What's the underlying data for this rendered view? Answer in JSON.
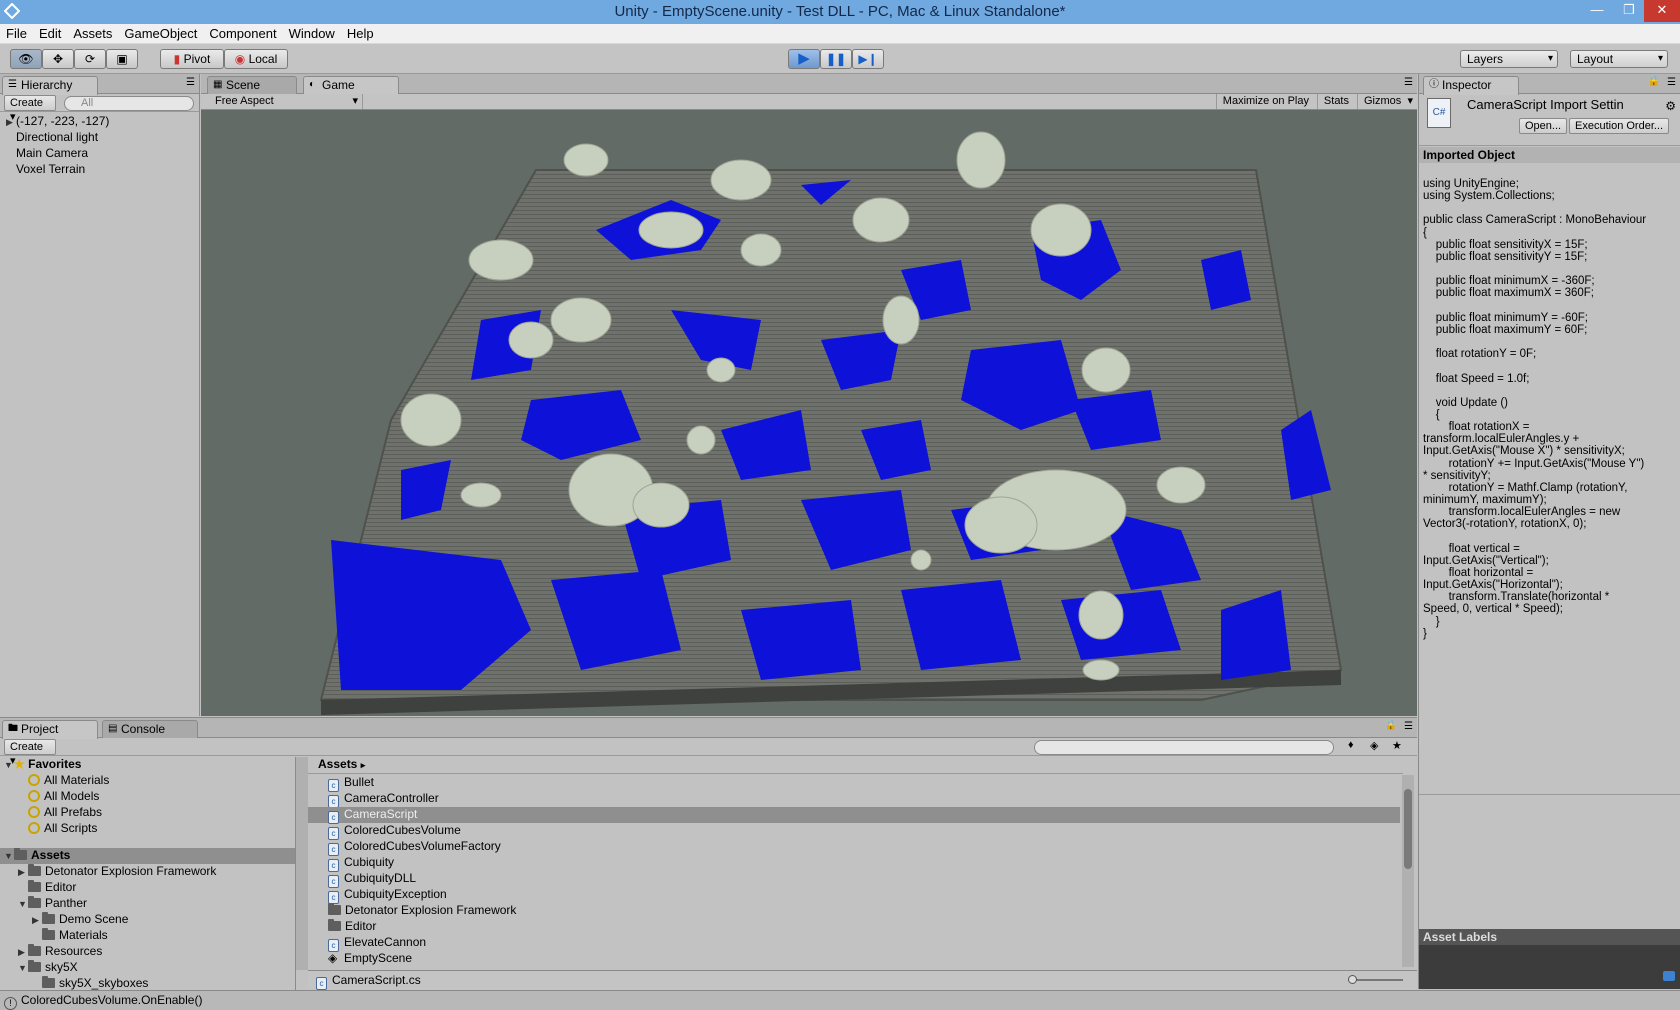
{
  "window": {
    "title": "Unity - EmptyScene.unity - Test DLL - PC, Mac & Linux Standalone*"
  },
  "menu": [
    "File",
    "Edit",
    "Assets",
    "GameObject",
    "Component",
    "Window",
    "Help"
  ],
  "toolbar": {
    "pivot": "Pivot",
    "local": "Local",
    "layers": "Layers",
    "layout": "Layout"
  },
  "hierarchy": {
    "tab": "Hierarchy",
    "create": "Create",
    "search_placeholder": "All",
    "items": [
      "(-127, -223, -127)",
      "Directional light",
      "Main Camera",
      "Voxel Terrain"
    ]
  },
  "viewtabs": {
    "scene": "Scene",
    "game": "Game"
  },
  "gamebar": {
    "aspect": "Free Aspect",
    "maximize": "Maximize on Play",
    "stats": "Stats",
    "gizmos": "Gizmos"
  },
  "inspector": {
    "tab": "Inspector",
    "title": "CameraScript Import Settin",
    "open": "Open...",
    "exec": "Execution Order...",
    "section": "Imported Object",
    "code": "using UnityEngine;\nusing System.Collections;\n\npublic class CameraScript : MonoBehaviour\n{\n    public float sensitivityX = 15F;\n    public float sensitivityY = 15F;\n\n    public float minimumX = -360F;\n    public float maximumX = 360F;\n\n    public float minimumY = -60F;\n    public float maximumY = 60F;\n\n    float rotationY = 0F;\n\n    float Speed = 1.0f;\n\n    void Update ()\n    {\n        float rotationX =\ntransform.localEulerAngles.y +\nInput.GetAxis(\"Mouse X\") * sensitivityX;\n        rotationY += Input.GetAxis(\"Mouse Y\")\n* sensitivityY;\n        rotationY = Mathf.Clamp (rotationY,\nminimumY, maximumY);\n        transform.localEulerAngles = new\nVector3(-rotationY, rotationX, 0);\n\n        float vertical =\nInput.GetAxis(\"Vertical\");\n        float horizontal =\nInput.GetAxis(\"Horizontal\");\n        transform.Translate(horizontal *\nSpeed, 0, vertical * Speed);\n    }\n}",
    "labels": "Asset Labels"
  },
  "project": {
    "tab": "Project",
    "console": "Console",
    "create": "Create",
    "favorites": "Favorites",
    "fav_items": [
      "All Materials",
      "All Models",
      "All Prefabs",
      "All Scripts"
    ],
    "assets_root": "Assets",
    "tree": [
      {
        "label": "Detonator Explosion Framework",
        "indent": 1,
        "arrow": "▶"
      },
      {
        "label": "Editor",
        "indent": 1,
        "arrow": ""
      },
      {
        "label": "Panther",
        "indent": 1,
        "arrow": "▼"
      },
      {
        "label": "Demo Scene",
        "indent": 2,
        "arrow": "▶"
      },
      {
        "label": "Materials",
        "indent": 2,
        "arrow": ""
      },
      {
        "label": "Resources",
        "indent": 1,
        "arrow": "▶"
      },
      {
        "label": "sky5X",
        "indent": 1,
        "arrow": "▼"
      },
      {
        "label": "sky5X_skyboxes",
        "indent": 2,
        "arrow": ""
      }
    ],
    "breadcrumb": "Assets",
    "assets": [
      {
        "label": "Bullet",
        "kind": "script"
      },
      {
        "label": "CameraController",
        "kind": "script"
      },
      {
        "label": "CameraScript",
        "kind": "script",
        "selected": true
      },
      {
        "label": "ColoredCubesVolume",
        "kind": "script"
      },
      {
        "label": "ColoredCubesVolumeFactory",
        "kind": "script"
      },
      {
        "label": "Cubiquity",
        "kind": "script"
      },
      {
        "label": "CubiquityDLL",
        "kind": "script"
      },
      {
        "label": "CubiquityException",
        "kind": "script"
      },
      {
        "label": "Detonator Explosion Framework",
        "kind": "folder"
      },
      {
        "label": "Editor",
        "kind": "folder"
      },
      {
        "label": "ElevateCannon",
        "kind": "script"
      },
      {
        "label": "EmptyScene",
        "kind": "scene"
      }
    ],
    "selected_file": "CameraScript.cs"
  },
  "status": "ColoredCubesVolume.OnEnable()"
}
